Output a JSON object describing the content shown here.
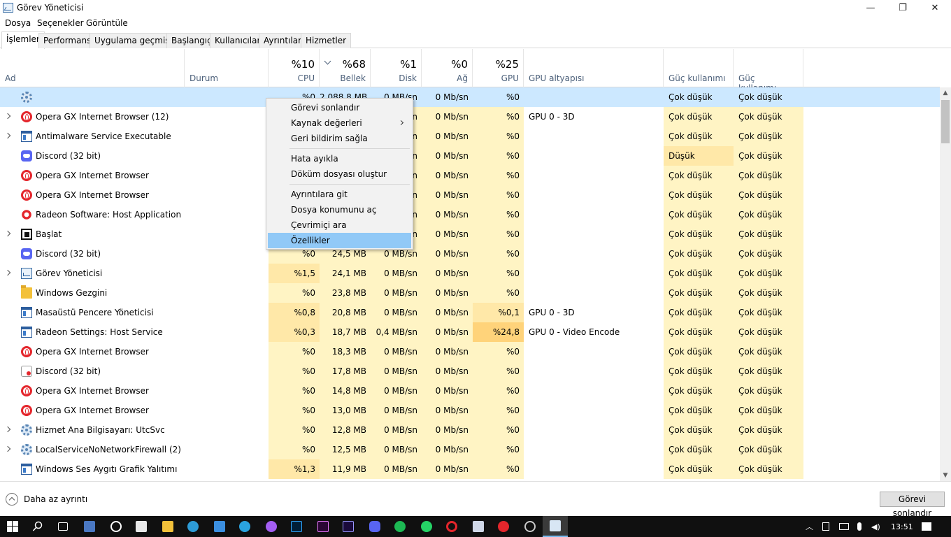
{
  "window": {
    "title": "Görev Yöneticisi",
    "minimize": "—",
    "maximize": "❐",
    "close": "✕"
  },
  "menu": [
    "Dosya",
    "Seçenekler",
    "Görüntüle"
  ],
  "tabs": [
    "İşlemler",
    "Performans",
    "Uygulama geçmişi",
    "Başlangıç",
    "Kullanıcılar",
    "Ayrıntılar",
    "Hizmetler"
  ],
  "columns": {
    "name": "Ad",
    "status": "Durum",
    "cpu": {
      "pct": "%10",
      "label": "CPU"
    },
    "memory": {
      "pct": "%68",
      "label": "Bellek"
    },
    "disk": {
      "pct": "%1",
      "label": "Disk"
    },
    "network": {
      "pct": "%0",
      "label": "Ağ"
    },
    "gpu": {
      "pct": "%25",
      "label": "GPU"
    },
    "gpu_engine": "GPU altyapısı",
    "power": "Güç kullanımı",
    "power_trend": "Güç kullanımı..."
  },
  "rows": [
    {
      "name": "",
      "icon": "gear-icon",
      "expand": false,
      "cpu": "%0",
      "mem": "2.088,8 MB",
      "disk": "0 MB/sn",
      "net": "0 Mb/sn",
      "gpu": "%0",
      "engine": "",
      "power": "Çok düşük",
      "trend": "Çok düşük"
    },
    {
      "name": "Opera GX Internet Browser (12)",
      "icon": "opera-icon",
      "expand": true,
      "cpu": "",
      "mem": "",
      "disk": "n",
      "net": "0 Mb/sn",
      "gpu": "%0",
      "engine": "GPU 0 - 3D",
      "power": "Çok düşük",
      "trend": "Çok düşük"
    },
    {
      "name": "Antimalware Service Executable",
      "icon": "window-icon",
      "expand": true,
      "cpu": "",
      "mem": "",
      "disk": "n",
      "net": "0 Mb/sn",
      "gpu": "%0",
      "engine": "",
      "power": "Çok düşük",
      "trend": "Çok düşük"
    },
    {
      "name": "Discord (32 bit)",
      "icon": "discord-icon",
      "expand": false,
      "cpu": "",
      "mem": "",
      "disk": "n",
      "net": "0 Mb/sn",
      "gpu": "%0",
      "engine": "",
      "power": "Düşük",
      "trend": "Çok düşük"
    },
    {
      "name": "Opera GX Internet Browser",
      "icon": "opera-icon",
      "expand": false,
      "cpu": "",
      "mem": "",
      "disk": "n",
      "net": "0 Mb/sn",
      "gpu": "%0",
      "engine": "",
      "power": "Çok düşük",
      "trend": "Çok düşük"
    },
    {
      "name": "Opera GX Internet Browser",
      "icon": "opera-icon",
      "expand": false,
      "cpu": "",
      "mem": "",
      "disk": "n",
      "net": "0 Mb/sn",
      "gpu": "%0",
      "engine": "",
      "power": "Çok düşük",
      "trend": "Çok düşük"
    },
    {
      "name": "Radeon Software: Host Application",
      "icon": "radeon-icon",
      "expand": false,
      "cpu": "",
      "mem": "",
      "disk": "n",
      "net": "0 Mb/sn",
      "gpu": "%0",
      "engine": "",
      "power": "Çok düşük",
      "trend": "Çok düşük"
    },
    {
      "name": "Başlat",
      "icon": "start-icon",
      "expand": true,
      "cpu": "",
      "mem": "",
      "disk": "n",
      "net": "0 Mb/sn",
      "gpu": "%0",
      "engine": "",
      "power": "Çok düşük",
      "trend": "Çok düşük"
    },
    {
      "name": "Discord (32 bit)",
      "icon": "discord-icon",
      "expand": false,
      "cpu": "%0",
      "mem": "24,5 MB",
      "disk": "0 MB/sn",
      "net": "0 Mb/sn",
      "gpu": "%0",
      "engine": "",
      "power": "Çok düşük",
      "trend": "Çok düşük"
    },
    {
      "name": "Görev Yöneticisi",
      "icon": "taskmgr-icon",
      "expand": true,
      "cpu": "%1,5",
      "mem": "24,1 MB",
      "disk": "0 MB/sn",
      "net": "0 Mb/sn",
      "gpu": "%0",
      "engine": "",
      "power": "Çok düşük",
      "trend": "Çok düşük"
    },
    {
      "name": "Windows Gezgini",
      "icon": "folder-icon",
      "expand": false,
      "cpu": "%0",
      "mem": "23,8 MB",
      "disk": "0 MB/sn",
      "net": "0 Mb/sn",
      "gpu": "%0",
      "engine": "",
      "power": "Çok düşük",
      "trend": "Çok düşük"
    },
    {
      "name": "Masaüstü Pencere Yöneticisi",
      "icon": "window-icon",
      "expand": false,
      "cpu": "%0,8",
      "mem": "20,8 MB",
      "disk": "0 MB/sn",
      "net": "0 Mb/sn",
      "gpu": "%0,1",
      "engine": "GPU 0 - 3D",
      "power": "Çok düşük",
      "trend": "Çok düşük"
    },
    {
      "name": "Radeon Settings: Host Service",
      "icon": "window-icon",
      "expand": false,
      "cpu": "%0,3",
      "mem": "18,7 MB",
      "disk": "0,4 MB/sn",
      "net": "0 Mb/sn",
      "gpu": "%24,8",
      "engine": "GPU 0 - Video Encode",
      "power": "Çok düşük",
      "trend": "Çok düşük"
    },
    {
      "name": "Opera GX Internet Browser",
      "icon": "opera-icon",
      "expand": false,
      "cpu": "%0",
      "mem": "18,3 MB",
      "disk": "0 MB/sn",
      "net": "0 Mb/sn",
      "gpu": "%0",
      "engine": "",
      "power": "Çok düşük",
      "trend": "Çok düşük"
    },
    {
      "name": "Discord (32 bit)",
      "icon": "discord-red-icon",
      "expand": false,
      "cpu": "%0",
      "mem": "17,8 MB",
      "disk": "0 MB/sn",
      "net": "0 Mb/sn",
      "gpu": "%0",
      "engine": "",
      "power": "Çok düşük",
      "trend": "Çok düşük"
    },
    {
      "name": "Opera GX Internet Browser",
      "icon": "opera-icon",
      "expand": false,
      "cpu": "%0",
      "mem": "14,8 MB",
      "disk": "0 MB/sn",
      "net": "0 Mb/sn",
      "gpu": "%0",
      "engine": "",
      "power": "Çok düşük",
      "trend": "Çok düşük"
    },
    {
      "name": "Opera GX Internet Browser",
      "icon": "opera-icon",
      "expand": false,
      "cpu": "%0",
      "mem": "13,0 MB",
      "disk": "0 MB/sn",
      "net": "0 Mb/sn",
      "gpu": "%0",
      "engine": "",
      "power": "Çok düşük",
      "trend": "Çok düşük"
    },
    {
      "name": "Hizmet Ana Bilgisayarı: UtcSvc",
      "icon": "gear-icon",
      "expand": true,
      "cpu": "%0",
      "mem": "12,8 MB",
      "disk": "0 MB/sn",
      "net": "0 Mb/sn",
      "gpu": "%0",
      "engine": "",
      "power": "Çok düşük",
      "trend": "Çok düşük"
    },
    {
      "name": "LocalServiceNoNetworkFirewall (2)",
      "icon": "gear-icon",
      "expand": true,
      "cpu": "%0",
      "mem": "12,5 MB",
      "disk": "0 MB/sn",
      "net": "0 Mb/sn",
      "gpu": "%0",
      "engine": "",
      "power": "Çok düşük",
      "trend": "Çok düşük"
    },
    {
      "name": "Windows Ses Aygıtı Grafik Yalıtımı",
      "icon": "window-icon",
      "expand": false,
      "cpu": "%1,3",
      "mem": "11,9 MB",
      "disk": "0 MB/sn",
      "net": "0 Mb/sn",
      "gpu": "%0",
      "engine": "",
      "power": "Çok düşük",
      "trend": "Çok düşük"
    }
  ],
  "context_menu": [
    "Görevi sonlandır",
    "Kaynak değerleri",
    "Geri bildirim sağla",
    "Hata ayıkla",
    "Döküm dosyası oluştur",
    "Ayrıntılara git",
    "Dosya konumunu aç",
    "Çevrimiçi ara",
    "Özellikler"
  ],
  "footer": {
    "fewer_details": "Daha az ayrıntı",
    "end_task": "Görevi sonlandır"
  },
  "taskbar": {
    "time": "13:51"
  },
  "colors": {
    "heat_light": "#fff4c4",
    "heat_medium": "#ffe8a8",
    "heat_high": "#ffd37a",
    "selected": "#cce8ff",
    "menu_highlight": "#91c9f7"
  }
}
